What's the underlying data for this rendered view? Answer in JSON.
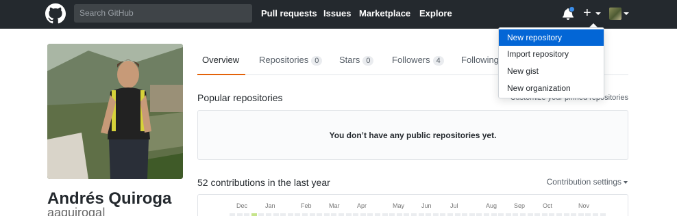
{
  "colors": {
    "header_bg": "#24292e",
    "accent": "#e36209",
    "link_active": "#0366d6",
    "notification_dot": "#3b8eea",
    "contribution_level1": "#c6e48b",
    "contribution_empty": "#ebedf0"
  },
  "header": {
    "logo_icon": "github-octocat-icon",
    "search_placeholder": "Search GitHub",
    "nav": [
      "Pull requests",
      "Issues",
      "Marketplace",
      "Explore"
    ],
    "notification_icon": "bell-icon",
    "create_icon": "plus-icon",
    "plus_glyph": "+"
  },
  "create_menu": {
    "items": [
      {
        "label": "New repository",
        "active": true
      },
      {
        "label": "Import repository",
        "active": false
      },
      {
        "label": "New gist",
        "active": false
      },
      {
        "label": "New organization",
        "active": false
      }
    ]
  },
  "profile": {
    "full_name": "Andrés Quiroga",
    "username": "aaquiroga|"
  },
  "tabs": [
    {
      "label": "Overview",
      "active": true
    },
    {
      "label": "Repositories",
      "count": "0"
    },
    {
      "label": "Stars",
      "count": "0"
    },
    {
      "label": "Followers",
      "count": "4"
    },
    {
      "label": "Following"
    }
  ],
  "popular": {
    "title": "Popular repositories",
    "customize_link": "Customize your pinned repositories",
    "empty_message": "You don’t have any public repositories yet."
  },
  "contributions": {
    "title": "52 contributions in the last year",
    "settings_label": "Contribution settings",
    "months": [
      "Dec",
      "Jan",
      "Feb",
      "Mar",
      "Apr",
      "May",
      "Jun",
      "Jul",
      "Aug",
      "Sep",
      "Oct",
      "Nov"
    ]
  }
}
